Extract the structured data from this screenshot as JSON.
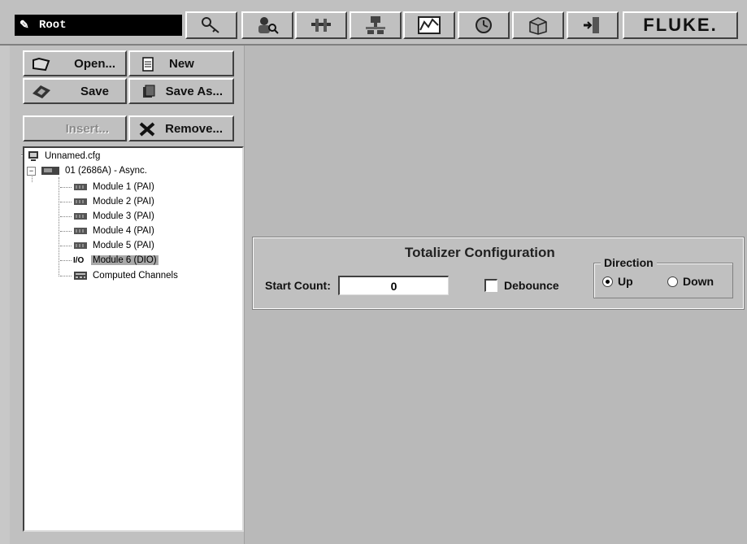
{
  "toolbar": {
    "user_name": "Root",
    "brand": "FLUKE.",
    "icons": [
      "key-icon",
      "user-search-icon",
      "tools-icon",
      "network-icon",
      "chart-icon",
      "alarm-icon",
      "box-icon",
      "exit-icon"
    ]
  },
  "file_buttons": {
    "open": "Open...",
    "new": "New",
    "save": "Save",
    "save_as": "Save As...",
    "insert": "Insert...",
    "remove": "Remove..."
  },
  "tree": {
    "root": "Unnamed.cfg",
    "instrument": "01 (2686A) - Async.",
    "modules": [
      "Module 1 (PAI)",
      "Module 2 (PAI)",
      "Module 3 (PAI)",
      "Module 4 (PAI)",
      "Module 5 (PAI)"
    ],
    "io_tag": "I/O",
    "selected_module": "Module 6 (DIO)",
    "computed": "Computed Channels"
  },
  "totalizer": {
    "title": "Totalizer Configuration",
    "start_count_label": "Start Count:",
    "start_count_value": "0",
    "debounce_label": "Debounce",
    "debounce_checked": false,
    "direction_label": "Direction",
    "direction_up": "Up",
    "direction_down": "Down",
    "direction_selected": "Up"
  }
}
